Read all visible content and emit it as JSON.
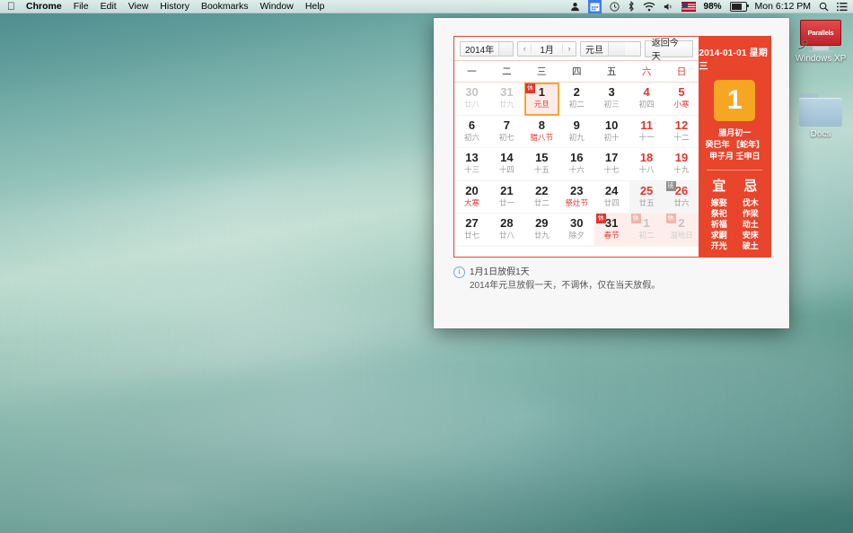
{
  "menubar": {
    "apple_icon": "apple-logo",
    "items": [
      {
        "label": "Chrome",
        "bold": true
      },
      {
        "label": "File",
        "bold": false
      },
      {
        "label": "Edit",
        "bold": false
      },
      {
        "label": "View",
        "bold": false
      },
      {
        "label": "History",
        "bold": false
      },
      {
        "label": "Bookmarks",
        "bold": false
      },
      {
        "label": "Window",
        "bold": false
      },
      {
        "label": "Help",
        "bold": false
      }
    ],
    "status": {
      "user_icon": "user-icon",
      "calendar_icon": "calendar-icon",
      "clock_icon": "clock-icon",
      "bluetooth_icon": "bluetooth-icon",
      "wifi_icon": "wifi-icon",
      "volume_icon": "volume-icon",
      "flag_icon": "us-flag-icon",
      "battery_percent": "98%",
      "battery_icon": "battery-icon",
      "time": "Mon 6:12 PM",
      "search_icon": "search-icon",
      "notification_icon": "notification-center-icon"
    }
  },
  "desktop": {
    "icons": [
      {
        "name": "windows-xp",
        "label": "Windows XP",
        "glyph": "Parallels"
      },
      {
        "name": "docs",
        "label": "Docs",
        "glyph": "folder"
      }
    ]
  },
  "calendar": {
    "toolbar": {
      "year": "2014年",
      "prev_arrow": "‹",
      "month": "1月",
      "next_arrow": "›",
      "festival": "元旦",
      "today_button": "返回今天"
    },
    "weekdays": [
      {
        "label": "一",
        "weekend": false
      },
      {
        "label": "二",
        "weekend": false
      },
      {
        "label": "三",
        "weekend": false
      },
      {
        "label": "四",
        "weekend": false
      },
      {
        "label": "五",
        "weekend": false
      },
      {
        "label": "六",
        "weekend": true
      },
      {
        "label": "日",
        "weekend": true
      }
    ],
    "days": [
      {
        "num": "30",
        "lunar": "廿八",
        "other": true
      },
      {
        "num": "31",
        "lunar": "廿九",
        "other": true
      },
      {
        "num": "1",
        "lunar": "元旦",
        "selected": true,
        "festival": true,
        "badge": "休",
        "badge_type": "rest"
      },
      {
        "num": "2",
        "lunar": "初二"
      },
      {
        "num": "3",
        "lunar": "初三"
      },
      {
        "num": "4",
        "lunar": "初四",
        "weekend": true
      },
      {
        "num": "5",
        "lunar": "小寒",
        "weekend": true,
        "festival": true
      },
      {
        "num": "6",
        "lunar": "初六"
      },
      {
        "num": "7",
        "lunar": "初七"
      },
      {
        "num": "8",
        "lunar": "腊八节",
        "festival": true
      },
      {
        "num": "9",
        "lunar": "初九"
      },
      {
        "num": "10",
        "lunar": "初十"
      },
      {
        "num": "11",
        "lunar": "十一",
        "weekend": true
      },
      {
        "num": "12",
        "lunar": "十二",
        "weekend": true
      },
      {
        "num": "13",
        "lunar": "十三"
      },
      {
        "num": "14",
        "lunar": "十四"
      },
      {
        "num": "15",
        "lunar": "十五"
      },
      {
        "num": "16",
        "lunar": "十六"
      },
      {
        "num": "17",
        "lunar": "十七"
      },
      {
        "num": "18",
        "lunar": "十八",
        "weekend": true
      },
      {
        "num": "19",
        "lunar": "十九",
        "weekend": true
      },
      {
        "num": "20",
        "lunar": "大寒",
        "festival": true
      },
      {
        "num": "21",
        "lunar": "廿一"
      },
      {
        "num": "22",
        "lunar": "廿二"
      },
      {
        "num": "23",
        "lunar": "祭灶节",
        "festival": true
      },
      {
        "num": "24",
        "lunar": "廿四"
      },
      {
        "num": "25",
        "lunar": "廿五",
        "weekend": true,
        "shaded": true
      },
      {
        "num": "26",
        "lunar": "廿六",
        "weekend": true,
        "shaded": true,
        "badge": "班",
        "badge_type": "work"
      },
      {
        "num": "27",
        "lunar": "廿七"
      },
      {
        "num": "28",
        "lunar": "廿八"
      },
      {
        "num": "29",
        "lunar": "廿九"
      },
      {
        "num": "30",
        "lunar": "除夕"
      },
      {
        "num": "31",
        "lunar": "春节",
        "festival": true,
        "pinkbg": true,
        "badge": "休",
        "badge_type": "rest"
      },
      {
        "num": "1",
        "lunar": "初二",
        "other": true,
        "pinkbg": true,
        "badge": "休",
        "badge_type": "rest-lite"
      },
      {
        "num": "2",
        "lunar": "湿地日",
        "other": true,
        "pinkbg": true,
        "badge": "休",
        "badge_type": "rest-lite"
      }
    ],
    "detail": {
      "date_header": "2014-01-01 星期三",
      "big_day": "1",
      "lunar_day": "腊月初一",
      "lunar_year": "癸巳年 【蛇年】",
      "lunar_ganzhi": "甲子月 壬申日",
      "yi_title": "宜",
      "ji_title": "忌",
      "yi_items": "嫁娶\n祭祀\n祈福\n求嗣\n开光",
      "ji_items": "伐木\n作梁\n动土\n安床\n破土"
    },
    "note": {
      "icon": "info-icon",
      "line1": "1月1日放假1天",
      "line2": "2014年元旦放假一天，不调休，仅在当天放假。"
    }
  }
}
